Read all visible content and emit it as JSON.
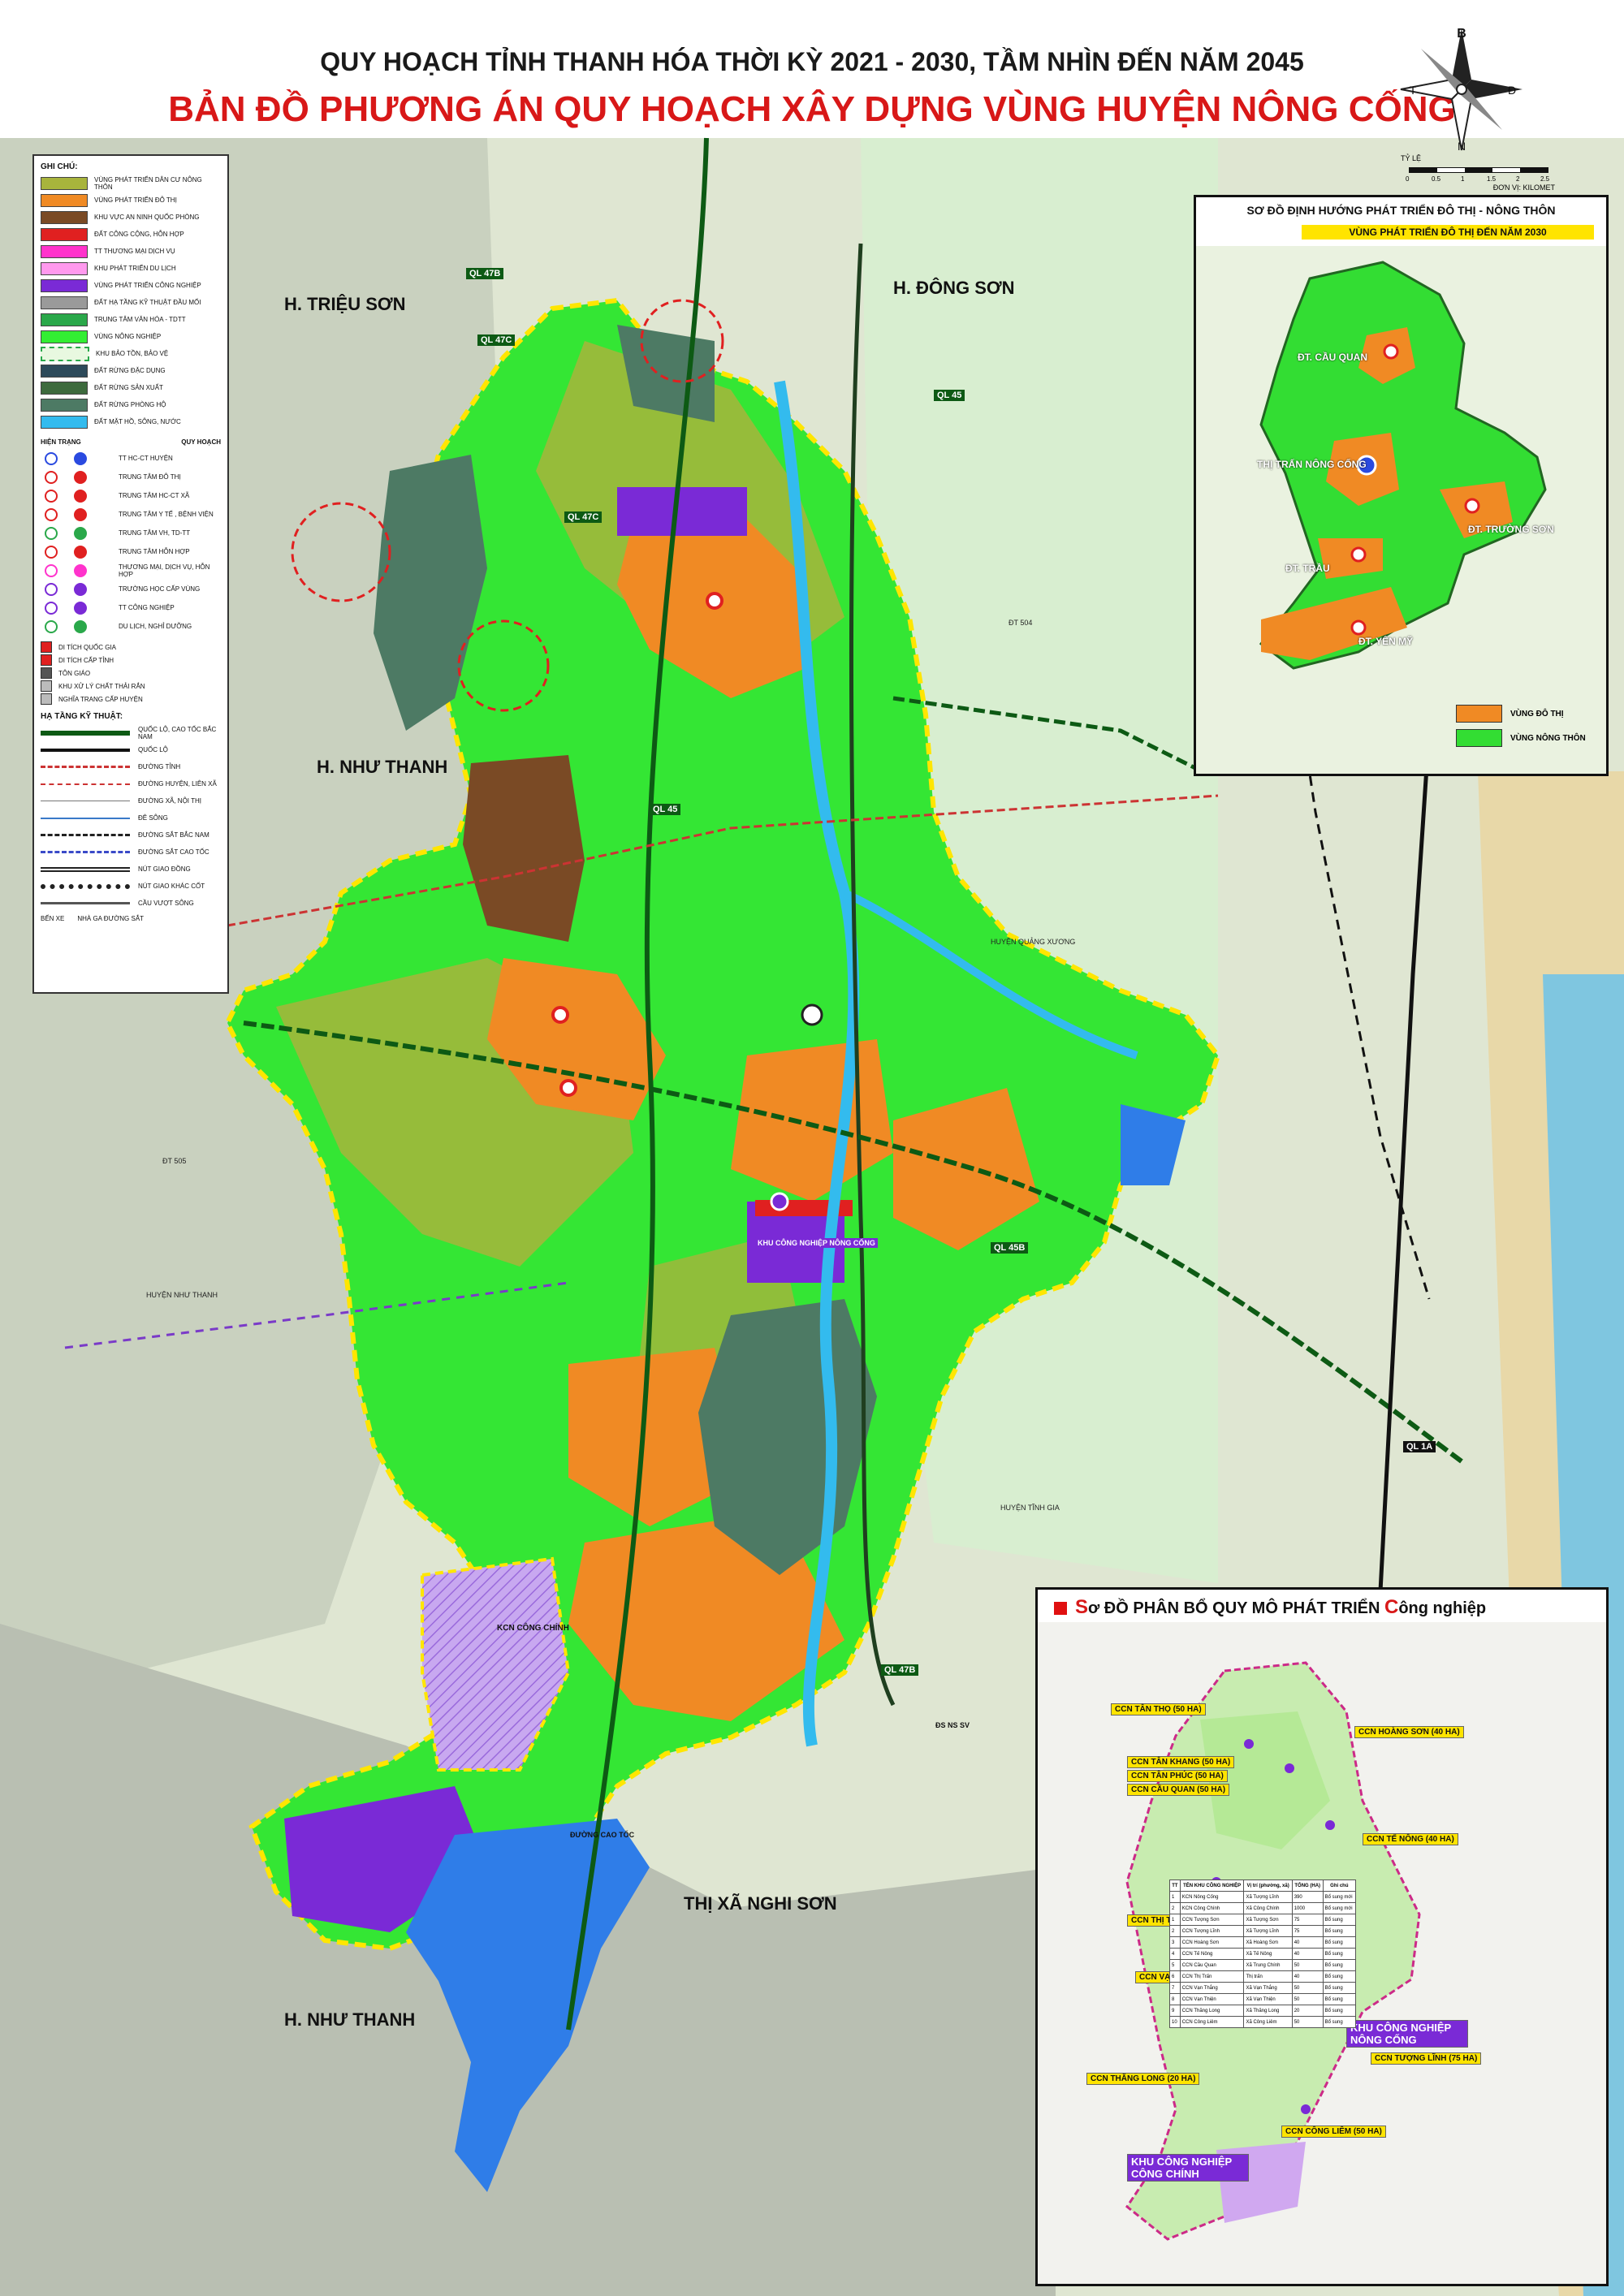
{
  "header": {
    "title_line1": "QUY HOẠCH TỈNH THANH HÓA THỜI KỲ 2021 - 2030, TẦM NHÌN ĐẾN NĂM 2045",
    "title_line2": "BẢN ĐỒ PHƯƠNG ÁN QUY HOẠCH XÂY DỰNG VÙNG HUYỆN NÔNG CỐNG"
  },
  "compass": {
    "north": "B",
    "south": "N",
    "east": "Đ",
    "west": "T"
  },
  "scale": {
    "label": "TỶ LỆ",
    "ticks": [
      "0",
      "0.5",
      "1",
      "1.5",
      "2",
      "2.5"
    ],
    "unit": "ĐƠN VỊ: KILOMET"
  },
  "legend": {
    "heading": "GHI CHÚ:",
    "zones": [
      {
        "label": "VÙNG PHÁT TRIỂN DÂN CƯ NÔNG THÔN",
        "color": "#a8b43c"
      },
      {
        "label": "VÙNG PHÁT TRIỂN ĐÔ THỊ",
        "color": "#f08a24"
      },
      {
        "label": "KHU VỰC AN NINH QUỐC PHÒNG",
        "color": "#7a4a25"
      },
      {
        "label": "ĐẤT CÔNG CỘNG, HỖN HỢP",
        "color": "#e02020"
      },
      {
        "label": "TT THƯƠNG MẠI DỊCH VỤ",
        "color": "#ff33cc"
      },
      {
        "label": "KHU PHÁT TRIỂN DU LỊCH",
        "color": "#ff99ee"
      },
      {
        "label": "VÙNG PHÁT TRIỂN CÔNG NGHIỆP",
        "color": "#7a2ad6"
      },
      {
        "label": "ĐẤT HẠ TẦNG KỸ THUẬT ĐẦU MỐI",
        "color": "#9a9a9a"
      },
      {
        "label": "TRUNG TÂM VĂN HÓA - TDTT",
        "color": "#2aa84a"
      },
      {
        "label": "VÙNG NÔNG NGHIỆP",
        "color": "#33ee33"
      },
      {
        "label": "KHU BẢO TỒN, BẢO VỆ",
        "color": "#e8f8e0"
      },
      {
        "label": "ĐẤT RỪNG ĐẶC DỤNG",
        "color": "#2d4a5a"
      },
      {
        "label": "ĐẤT RỪNG SẢN XUẤT",
        "color": "#3d6a3d"
      },
      {
        "label": "ĐẤT RỪNG PHÒNG HỘ",
        "color": "#4d7a64"
      },
      {
        "label": "ĐẤT MẶT HỒ, SÔNG, NƯỚC",
        "color": "#33bbee"
      }
    ],
    "status_header": "HIỆN TRẠNG",
    "plan_header": "QUY HOẠCH",
    "symbols": [
      "TT HC-CT HUYỆN",
      "TRUNG TÂM ĐÔ THỊ",
      "TRUNG TÂM HC-CT XÃ",
      "TRUNG TÂM Y TẾ , BỆNH VIỆN",
      "TRUNG TÂM VH, TD-TT",
      "TRUNG TÂM HỖN HỢP",
      "THƯƠNG MẠI, DỊCH VỤ, HỖN HỢP",
      "TRƯỜNG HỌC CẤP VÙNG",
      "TT CÔNG NGHIỆP",
      "DU LỊCH, NGHỈ DƯỠNG"
    ],
    "misc": [
      "DI TÍCH QUỐC GIA",
      "DI TÍCH CẤP TỈNH",
      "TÔN GIÁO",
      "KHU XỬ LÝ CHẤT THẢI RẮN",
      "NGHĨA TRANG CẤP HUYỆN"
    ],
    "infra_heading": "HẠ TẦNG KỸ THUẬT:",
    "infra": [
      "QUỐC LỘ, CAO TỐC BẮC NAM",
      "QUỐC LỘ",
      "ĐƯỜNG TỈNH",
      "ĐƯỜNG HUYỆN, LIÊN XÃ",
      "ĐƯỜNG XÃ, NỘI THỊ",
      "ĐÊ SÔNG",
      "ĐƯỜNG SẮT BẮC NAM",
      "ĐƯỜNG SẮT CAO TỐC",
      "NÚT GIAO ĐỒNG",
      "NÚT GIAO KHÁC CỐT",
      "CẦU VƯỢT SÔNG"
    ],
    "infra_extra": [
      "BẾN XE",
      "NHÀ GA ĐƯỜNG SẮT"
    ]
  },
  "map_labels": {
    "trieu_son": "H. TRIỆU SƠN",
    "dong_son": "H. ĐÔNG SƠN",
    "nhu_thanh_1": "H. NHƯ THANH",
    "nhu_thanh_2": "H. NHƯ THANH",
    "nghi_son": "THỊ XÃ NGHI SƠN",
    "huyen_nhu_thanh": "HUYỆN NHƯ THANH",
    "huyen_quang_xuong": "HUYỆN QUẢNG XƯƠNG",
    "huyen_tinh_gia": "HUYỆN TĨNH GIA",
    "kcn_nong_cong": "KHU CÔNG NGHIỆP NÔNG CỐNG",
    "kcn_cong_chinh": "KCN CÔNG CHÍNH",
    "ql47b": "QL 47B",
    "ql47c_1": "QL 47C",
    "ql47c_2": "QL 47C",
    "ql45_1": "QL 45",
    "ql45_2": "QL 45",
    "ql45b": "QL 45B",
    "ql47b_2": "QL 47B",
    "ql1a": "QL 1A",
    "dt504": "ĐT 504",
    "dt505": "ĐT 505",
    "caotoc": "ĐƯỜNG CAO TỐC",
    "dsns": "ĐS NS SV",
    "g": "G"
  },
  "inset1": {
    "title": "SƠ ĐỒ ĐỊNH HƯỚNG PHÁT TRIỂN ĐÔ THỊ - NÔNG THÔN",
    "subtitle": "VÙNG PHÁT TRIỂN ĐÔ THỊ ĐẾN NĂM 2030",
    "towns": [
      "ĐT. CẦU QUAN",
      "THỊ TRẤN NÔNG CỐNG",
      "ĐT. TRƯỜNG SƠN",
      "ĐT. TRẦU",
      "ĐT. YÊN MỸ"
    ],
    "legend": [
      {
        "label": "VÙNG ĐÔ THỊ",
        "color": "#f08a24"
      },
      {
        "label": "VÙNG NÔNG THÔN",
        "color": "#33dd33"
      }
    ]
  },
  "inset2": {
    "title_prefix": "S",
    "title_mid": "ơ ĐỒ PHÂN BỔ QUY MÔ PHÁT TRIỂN ",
    "title_cap": "C",
    "title_end": "ông nghiệp",
    "labels": [
      "CCN TÂN THỌ (50 HA)",
      "CCN HOÀNG SƠN (40 HA)",
      "CCN TÂN KHANG (50 HA)",
      "CCN TÂN PHÚC (50 HA)",
      "CCN CẦU QUAN (50 HA)",
      "CCN TẾ NÔNG (40 HA)",
      "CCN THỊ TRẤN (40 HA)",
      "CCN VẠN THẮNG (50 HA)",
      "CCN VẠN THIỆN (50 HA)",
      "KHU CÔNG NGHIỆP NÔNG CỐNG",
      "CCN TƯỢNG LĨNH (75 HA)",
      "CCN THĂNG LONG (20 HA)",
      "CCN CÔNG LIÊM (50 HA)",
      "KHU CÔNG NGHIỆP CÔNG CHÍNH"
    ],
    "table_headers": [
      "TT",
      "TÊN KHU CÔNG NGHIỆP",
      "Vị trí (phường, xã)",
      "TỔNG (HA)",
      "Ghi chú"
    ],
    "table_rows": [
      [
        "1",
        "KCN Nông Cống",
        "Xã Tượng Lĩnh",
        "390",
        "Bổ sung mới"
      ],
      [
        "2",
        "KCN Công Chính",
        "Xã Công Chính",
        "1000",
        "Bổ sung mới"
      ],
      [
        "1",
        "CCN Tượng Sơn",
        "Xã Tượng Sơn",
        "75",
        "Bổ sung"
      ],
      [
        "2",
        "CCN Tượng Lĩnh",
        "Xã Tượng Lĩnh",
        "75",
        "Bổ sung"
      ],
      [
        "3",
        "CCN Hoàng Sơn",
        "Xã Hoàng Sơn",
        "40",
        "Bổ sung"
      ],
      [
        "4",
        "CCN Tế Nông",
        "Xã Tế Nông",
        "40",
        "Bổ sung"
      ],
      [
        "5",
        "CCN Cầu Quan",
        "Xã Trung Chính",
        "50",
        "Bổ sung"
      ],
      [
        "6",
        "CCN Thị Trấn",
        "Thị trấn",
        "40",
        "Bổ sung"
      ],
      [
        "7",
        "CCN Vạn Thắng",
        "Xã Vạn Thắng",
        "50",
        "Bổ sung"
      ],
      [
        "8",
        "CCN Vạn Thiện",
        "Xã Vạn Thiện",
        "50",
        "Bổ sung"
      ],
      [
        "9",
        "CCN Thăng Long",
        "Xã Thăng Long",
        "20",
        "Bổ sung"
      ],
      [
        "10",
        "CCN Công Liêm",
        "Xã Công Liêm",
        "50",
        "Bổ sung"
      ]
    ]
  }
}
